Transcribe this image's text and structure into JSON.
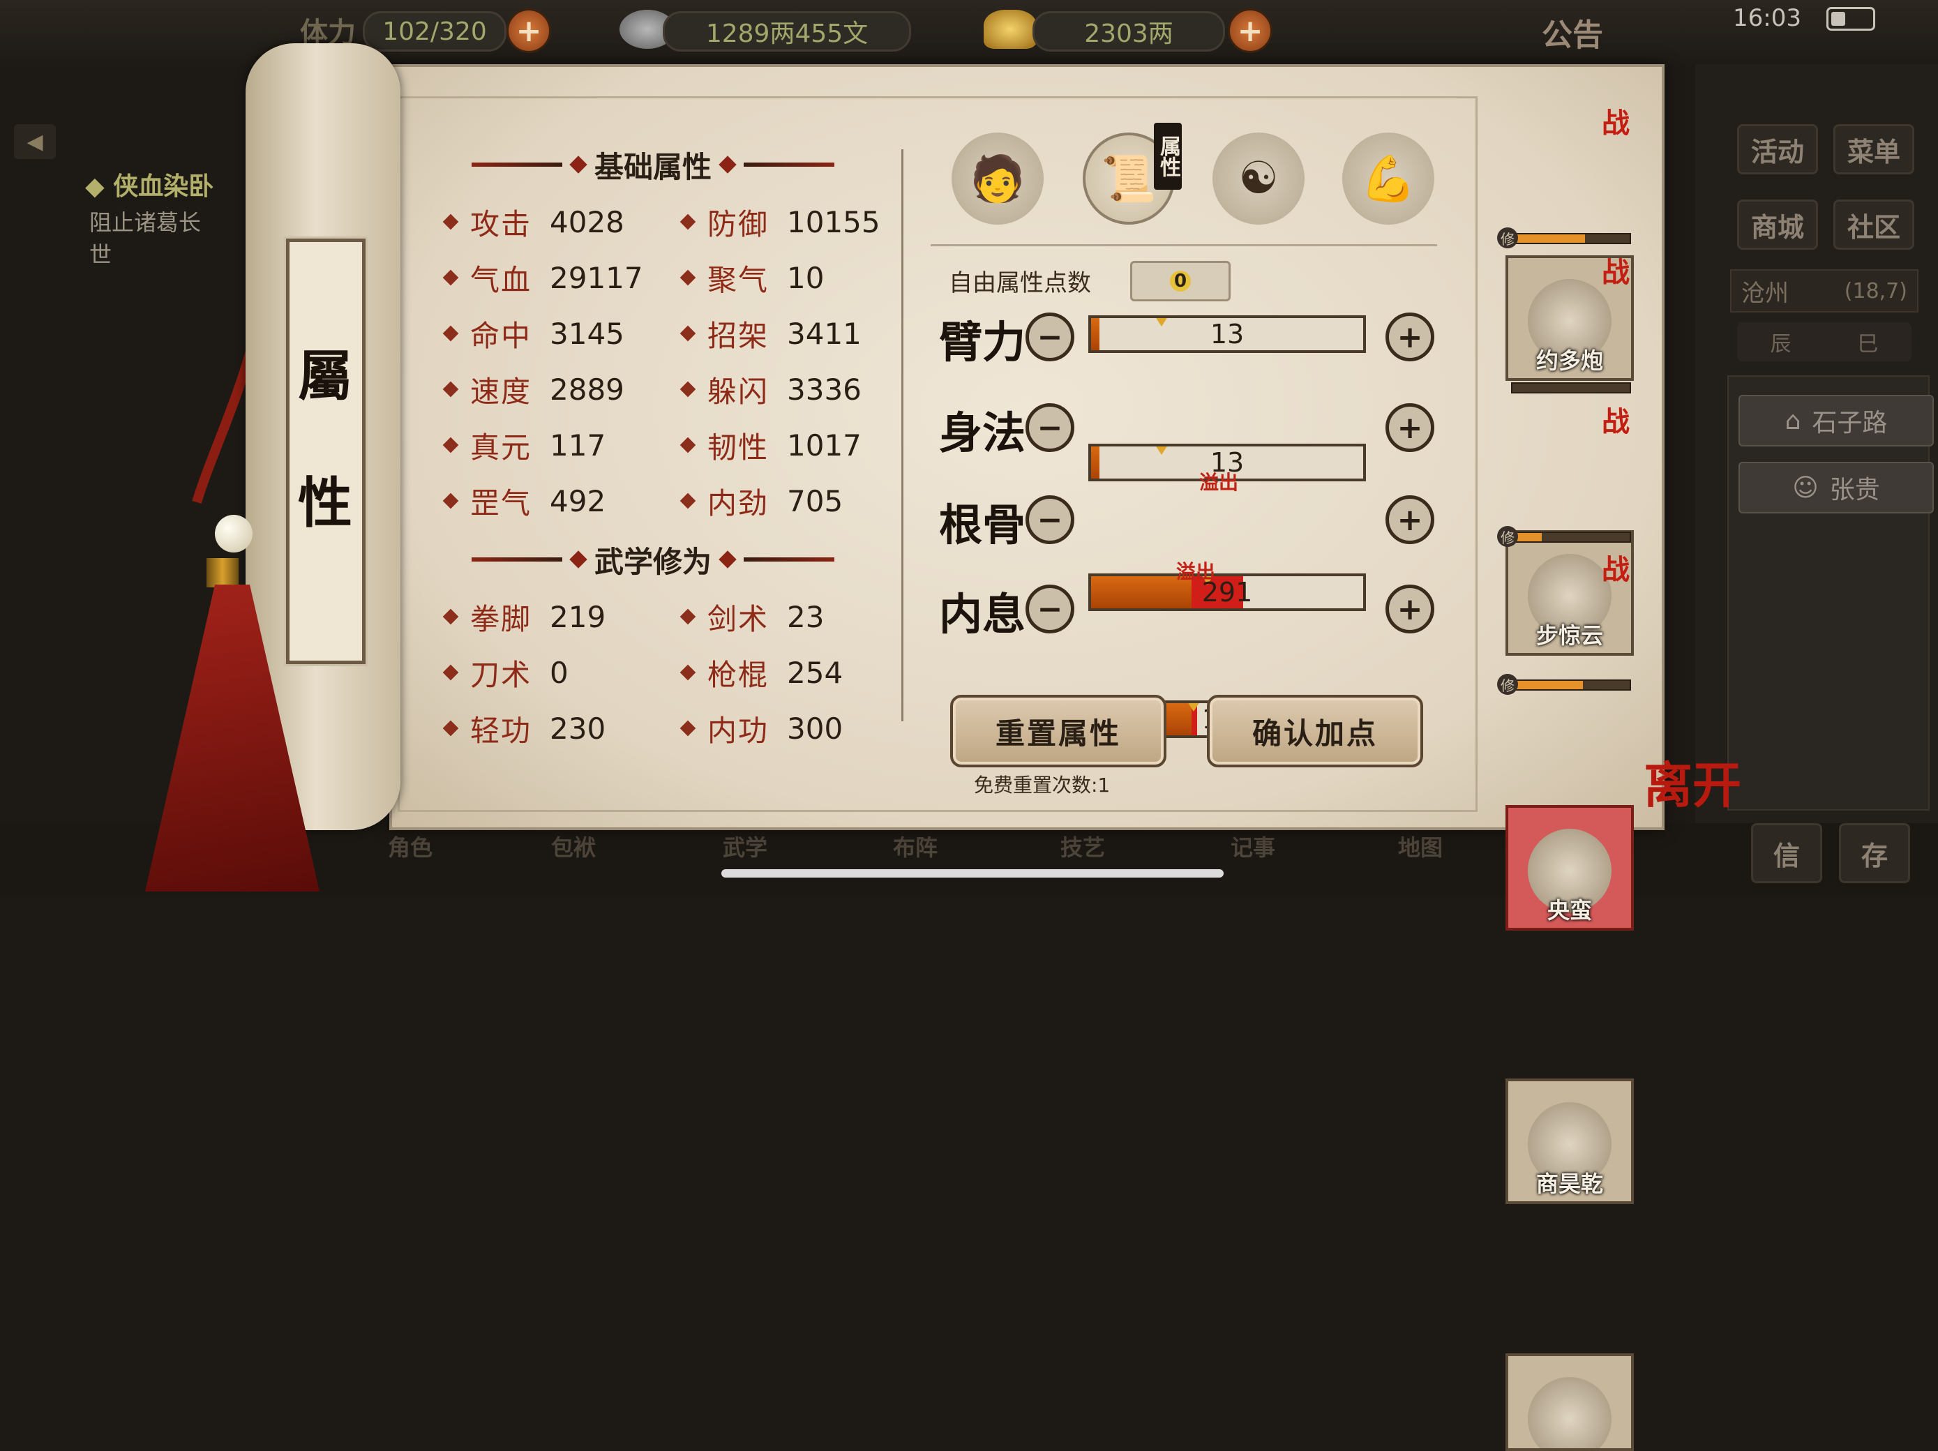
{
  "top_bar": {
    "stamina_label": "体力",
    "stamina_value": "102/320",
    "silver_value": "1289两455文",
    "gold_value": "2303两",
    "notice_label": "公告",
    "time": "16:03",
    "icons": {
      "silver": "silver-ingot-icon",
      "gold": "gold-ingot-icon",
      "add": "plus-icon",
      "battery": "battery-icon"
    }
  },
  "background_left": {
    "quest_title": "侠血染卧",
    "quest_text_line1": "阻止诸葛长",
    "quest_text_line2": "世"
  },
  "background_right": {
    "buttons": [
      {
        "label": "活动"
      },
      {
        "label": "菜单"
      },
      {
        "label": "商城"
      },
      {
        "label": "社区"
      }
    ],
    "location_name": "沧州",
    "location_coords": "(18,7)",
    "time_marks": [
      "辰",
      "巳"
    ],
    "places": [
      {
        "label": "石子路"
      },
      {
        "label": "张贵"
      }
    ]
  },
  "bottom_nav": {
    "items": [
      {
        "label": "角色"
      },
      {
        "label": "包袱"
      },
      {
        "label": "武学"
      },
      {
        "label": "布阵"
      },
      {
        "label": "技艺"
      },
      {
        "label": "记事"
      },
      {
        "label": "地图"
      }
    ],
    "right_buttons": [
      {
        "label": "信"
      },
      {
        "label": "存"
      }
    ]
  },
  "scroll_tab": {
    "title_char_1": "屬",
    "title_char_2": "性"
  },
  "basic_attributes": {
    "heading": "基础属性",
    "stats": [
      {
        "label": "攻击",
        "value": "4028"
      },
      {
        "label": "防御",
        "value": "10155"
      },
      {
        "label": "气血",
        "value": "29117"
      },
      {
        "label": "聚气",
        "value": "10"
      },
      {
        "label": "命中",
        "value": "3145"
      },
      {
        "label": "招架",
        "value": "3411"
      },
      {
        "label": "速度",
        "value": "2889"
      },
      {
        "label": "躲闪",
        "value": "3336"
      },
      {
        "label": "真元",
        "value": "117"
      },
      {
        "label": "韧性",
        "value": "1017"
      },
      {
        "label": "罡气",
        "value": "492"
      },
      {
        "label": "内劲",
        "value": "705"
      }
    ]
  },
  "martial_cultivation": {
    "heading": "武学修为",
    "stats": [
      {
        "label": "拳脚",
        "value": "219"
      },
      {
        "label": "剑术",
        "value": "23"
      },
      {
        "label": "刀术",
        "value": "0"
      },
      {
        "label": "枪棍",
        "value": "254"
      },
      {
        "label": "轻功",
        "value": "230"
      },
      {
        "label": "内功",
        "value": "300"
      }
    ]
  },
  "tabs": {
    "active_tag": "属性",
    "items": [
      {
        "icon": "straw-hat-character-icon"
      },
      {
        "icon": "scroll-book-icon"
      },
      {
        "icon": "bagua-icon"
      },
      {
        "icon": "muscle-body-icon"
      }
    ]
  },
  "free_points": {
    "label": "自由属性点数",
    "value": "0"
  },
  "attributes": [
    {
      "name": "臂力",
      "value": "13",
      "fill": 0.03,
      "overflow": 0,
      "overflow_label": ""
    },
    {
      "name": "身法",
      "value": "13",
      "fill": 0.03,
      "overflow": 0,
      "overflow_label": ""
    },
    {
      "name": "根骨",
      "value": "291",
      "fill": 0.37,
      "overflow": 0.19,
      "overflow_label": "溢出"
    },
    {
      "name": "内息",
      "value": "188",
      "fill": 0.37,
      "overflow": 0.02,
      "overflow_label": "溢出"
    }
  ],
  "buttons": {
    "reset": "重置属性",
    "confirm": "确认加点",
    "free_reset": "免费重置次数:1",
    "minus": "−",
    "plus": "+",
    "leave": "离开"
  },
  "party": [
    {
      "name": "约多炮",
      "battle_tag": "战",
      "cultivation": 0.62,
      "xiu": "修",
      "highlight": false
    },
    {
      "name": "步惊云",
      "battle_tag": "战",
      "cultivation": 0.0,
      "xiu": "",
      "highlight": false
    },
    {
      "name": "央蛮",
      "battle_tag": "战",
      "cultivation": 0.25,
      "xiu": "修",
      "highlight": true
    },
    {
      "name": "商昊乾",
      "battle_tag": "战",
      "cultivation": 0.6,
      "xiu": "修",
      "highlight": false
    },
    {
      "name": "",
      "battle_tag": "",
      "cultivation": 0,
      "xiu": "",
      "highlight": false
    }
  ],
  "colors": {
    "stat_label": "#8e2a18",
    "bar_fill": "#c9560c",
    "overflow_red": "#d21e18",
    "battle_tag": "#c41e12"
  }
}
